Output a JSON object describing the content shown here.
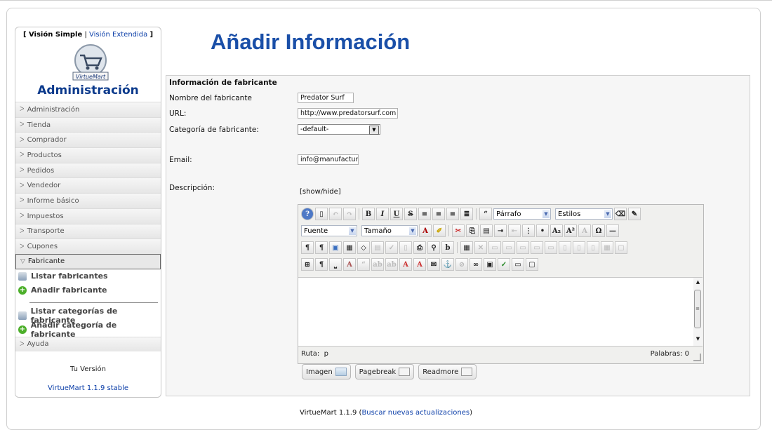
{
  "view_switch": {
    "simple": "[ Visión Simple",
    "separator": "|",
    "extended": "Visión Extendida",
    "close": "]"
  },
  "logo_text": "VirtueMart",
  "admin_title": "Administración",
  "menu": [
    {
      "label": "Administración"
    },
    {
      "label": "Tienda"
    },
    {
      "label": "Comprador"
    },
    {
      "label": "Productos"
    },
    {
      "label": "Pedidos"
    },
    {
      "label": "Vendedor"
    },
    {
      "label": "Informe básico"
    },
    {
      "label": "Impuestos"
    },
    {
      "label": "Transporte"
    },
    {
      "label": "Cupones"
    },
    {
      "label": "Fabricante"
    }
  ],
  "submenu": {
    "list_manufacturers": "Listar fabricantes",
    "add_manufacturer": "Añadir fabricante",
    "list_categories": "Listar categorías de fabricante",
    "add_category": "Añadir categoría de fabricante"
  },
  "menu_help": "Ayuda",
  "version_label": "Tu Versión",
  "version_value": "VirtueMart 1.1.9 stable",
  "page_title": "Añadir Información",
  "form": {
    "section": "Información de fabricante",
    "name_label": "Nombre del fabricante",
    "name_value": "Predator Surf",
    "url_label": "URL:",
    "url_value": "http://www.predatorsurf.com",
    "category_label": "Categoría de fabricante:",
    "category_value": "-default-",
    "email_label": "Email:",
    "email_value": "info@manufacturer",
    "description_label": "Descripción:",
    "show_hide": "[show/hide]"
  },
  "editor": {
    "format_select": "Párrafo",
    "styles_select": "Estilos",
    "font_select": "Fuente",
    "size_select": "Tamaño",
    "path_label": "Ruta:",
    "path_value": "p",
    "words_label": "Palabras: 0"
  },
  "buttons": {
    "image": "Imagen",
    "pagebreak": "Pagebreak",
    "readmore": "Readmore"
  },
  "footer": {
    "version": "VirtueMart 1.1.9",
    "open": "(",
    "link": "Buscar nuevas actualizaciones",
    "close": ")"
  }
}
